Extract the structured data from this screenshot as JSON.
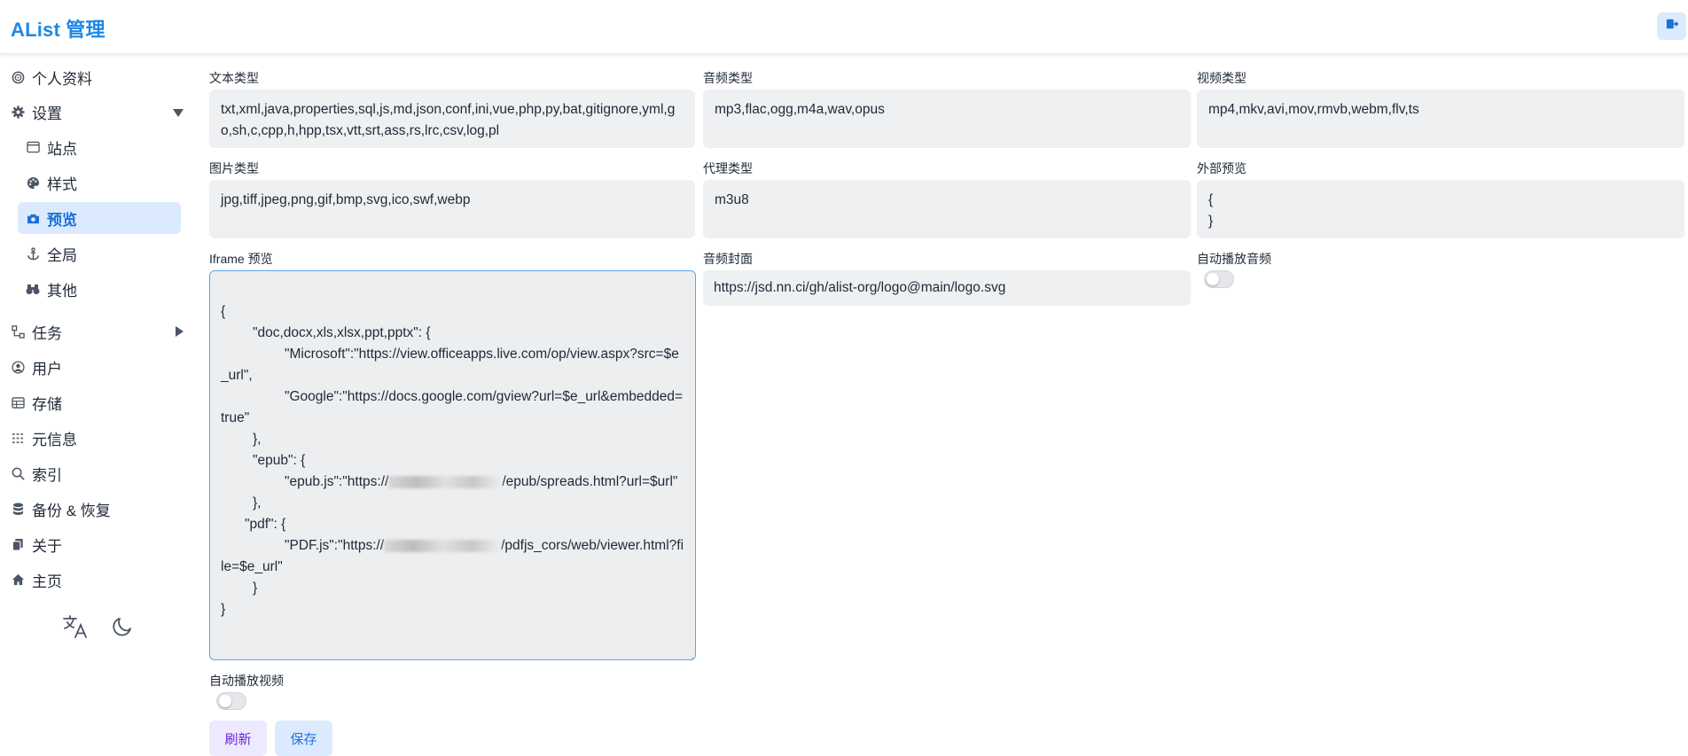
{
  "header": {
    "brand": "AList 管理"
  },
  "sidebar": {
    "items": [
      {
        "label": "个人资料",
        "icon": "fingerprint-icon"
      },
      {
        "label": "设置",
        "icon": "gear-icon"
      },
      {
        "label": "站点",
        "icon": "window-icon"
      },
      {
        "label": "样式",
        "icon": "palette-icon"
      },
      {
        "label": "预览",
        "icon": "camera-icon"
      },
      {
        "label": "全局",
        "icon": "anchor-icon"
      },
      {
        "label": "其他",
        "icon": "binoculars-icon"
      },
      {
        "label": "任务",
        "icon": "tasks-icon"
      },
      {
        "label": "用户",
        "icon": "user-circle-icon"
      },
      {
        "label": "存储",
        "icon": "storage-icon"
      },
      {
        "label": "元信息",
        "icon": "metadata-icon"
      },
      {
        "label": "索引",
        "icon": "search-icon"
      },
      {
        "label": "备份 & 恢复",
        "icon": "database-icon"
      },
      {
        "label": "关于",
        "icon": "copy-icon"
      },
      {
        "label": "主页",
        "icon": "home-icon"
      }
    ]
  },
  "form": {
    "text_types": {
      "label": "文本类型",
      "value": "txt,xml,java,properties,sql,js,md,json,conf,ini,vue,php,py,bat,gitignore,yml,go,sh,c,cpp,h,hpp,tsx,vtt,srt,ass,rs,lrc,csv,log,pl"
    },
    "audio_types": {
      "label": "音频类型",
      "value": "mp3,flac,ogg,m4a,wav,opus"
    },
    "video_types": {
      "label": "视频类型",
      "value": "mp4,mkv,avi,mov,rmvb,webm,flv,ts"
    },
    "image_types": {
      "label": "图片类型",
      "value": "jpg,tiff,jpeg,png,gif,bmp,svg,ico,swf,webp"
    },
    "proxy_types": {
      "label": "代理类型",
      "value": "m3u8"
    },
    "external_preview": {
      "label": "外部预览",
      "value": "{\n}"
    },
    "iframe_preview": {
      "label": "Iframe 预览",
      "line1": "{",
      "line2": "\"doc,docx,xls,xlsx,ppt,pptx\": {",
      "line3": "\"Microsoft\":\"https://view.officeapps.live.com/op/view.aspx?src=$e_url\",",
      "line4": "\"Google\":\"https://docs.google.com/gview?url=$e_url&embedded=true\"",
      "line5": "},",
      "line6": "\"epub\": {",
      "line7a": "\"epub.js\":\"https://",
      "line7b": "/epub/spreads.html?url=$url\"",
      "line8": "},",
      "line9": "\"pdf\": {",
      "line10a": "\"PDF.js\":\"https://",
      "line10b": "/pdfjs_cors/web/viewer.html?file=$e_url\"",
      "line11": "}",
      "line12": "}"
    },
    "audio_cover": {
      "label": "音频封面",
      "value": "https://jsd.nn.ci/gh/alist-org/logo@main/logo.svg"
    },
    "autoplay_audio": {
      "label": "自动播放音频"
    },
    "autoplay_video": {
      "label": "自动播放视频"
    }
  },
  "actions": {
    "refresh": "刷新",
    "save": "保存"
  }
}
